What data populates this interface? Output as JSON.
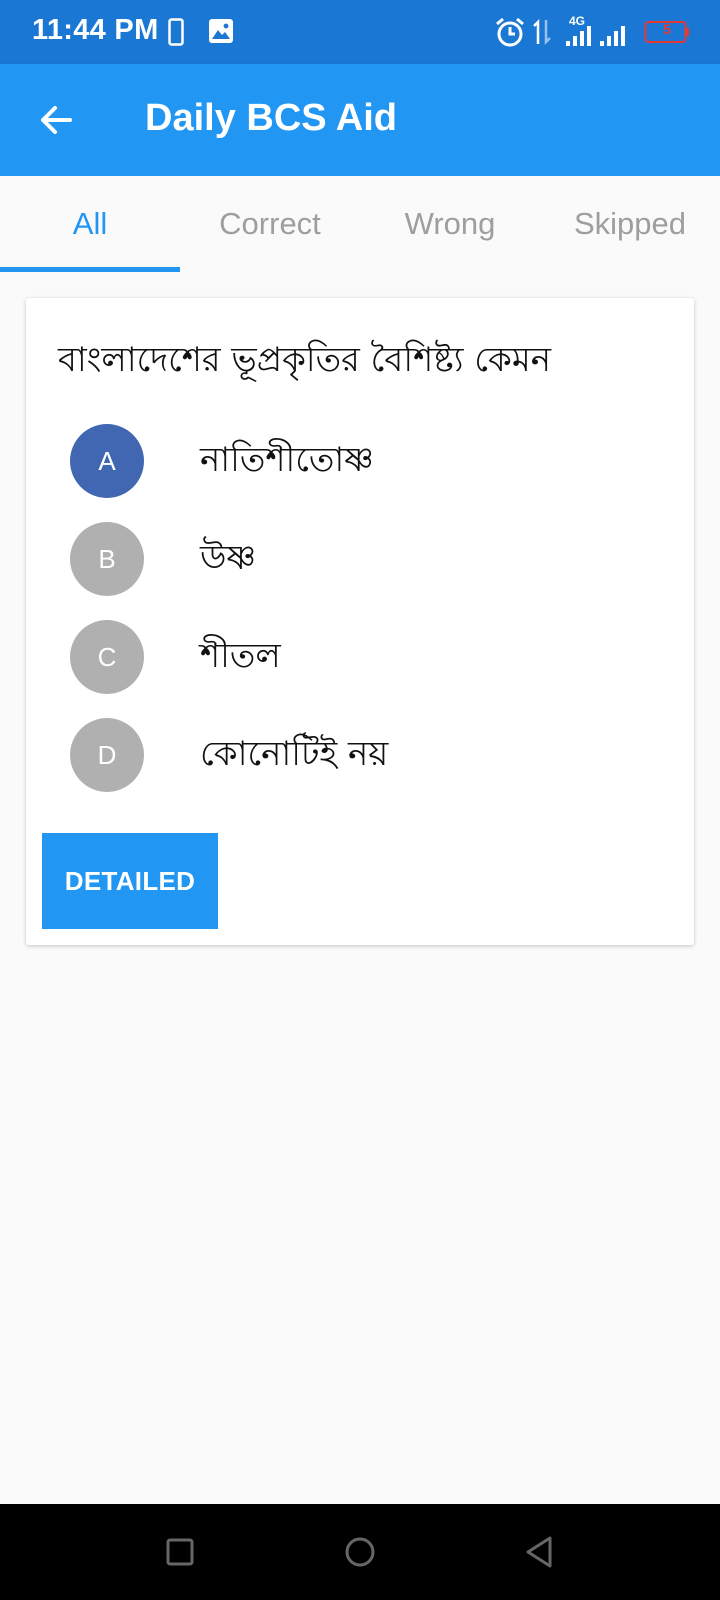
{
  "status_bar": {
    "time": "11:44 PM",
    "network": "4G",
    "battery_level": "5",
    "icons": [
      "phone-icon",
      "image-icon",
      "alarm-icon",
      "data-transfer-icon",
      "signal-icon",
      "battery-icon"
    ]
  },
  "app_bar": {
    "title": "Daily BCS Aid",
    "back_icon": "arrow-left-icon"
  },
  "tabs": [
    {
      "label": "All",
      "active": true
    },
    {
      "label": "Correct",
      "active": false
    },
    {
      "label": "Wrong",
      "active": false
    },
    {
      "label": "Skipped",
      "active": false
    }
  ],
  "question_card": {
    "question": "বাংলাদেশের ভূপ্রকৃতির বৈশিষ্ট্য কেমন",
    "options": [
      {
        "letter": "A",
        "text": "নাতিশীতোষ্ণ",
        "selected": true
      },
      {
        "letter": "B",
        "text": "উষ্ণ",
        "selected": false
      },
      {
        "letter": "C",
        "text": "শীতল",
        "selected": false
      },
      {
        "letter": "D",
        "text": "কোনোটিই নয়",
        "selected": false
      }
    ],
    "detail_button": "DETAILED"
  },
  "nav_bar": {
    "buttons": [
      "recents-square-icon",
      "home-circle-icon",
      "back-triangle-icon"
    ]
  },
  "colors": {
    "status_bar": "#1a78d4",
    "app_bar": "#2196f3",
    "accent": "#2196f3",
    "selected_option": "#4267b2",
    "unselected_option": "#b0b0b0",
    "background": "#fafafa"
  }
}
